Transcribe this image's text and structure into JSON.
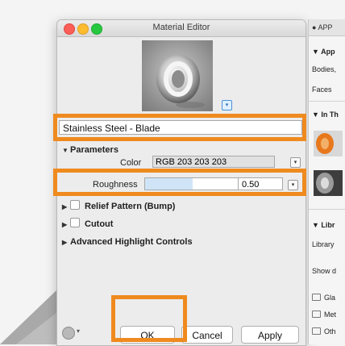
{
  "window": {
    "title": "Material Editor"
  },
  "material": {
    "name": "Stainless Steel - Blade"
  },
  "parameters": {
    "header": "Parameters",
    "color_label": "Color",
    "color_value": "RGB 203 203 203",
    "roughness_label": "Roughness",
    "roughness_value": "0.50",
    "roughness_fraction": 0.5
  },
  "sections": {
    "relief": "Relief Pattern (Bump)",
    "cutout": "Cutout",
    "advanced": "Advanced Highlight Controls"
  },
  "buttons": {
    "ok": "OK",
    "cancel": "Cancel",
    "apply": "Apply"
  },
  "panel": {
    "header": "APP",
    "appear": "App",
    "bodies": "Bodies,",
    "faces": "Faces",
    "in_this": "In Th",
    "library": "Libr",
    "library_label": "Library",
    "show": "Show d",
    "folders": [
      "Gla",
      "Met",
      "Oth"
    ]
  },
  "colors": {
    "highlight": "#ef8a1f",
    "slider_fill": "#cfe5f7"
  }
}
